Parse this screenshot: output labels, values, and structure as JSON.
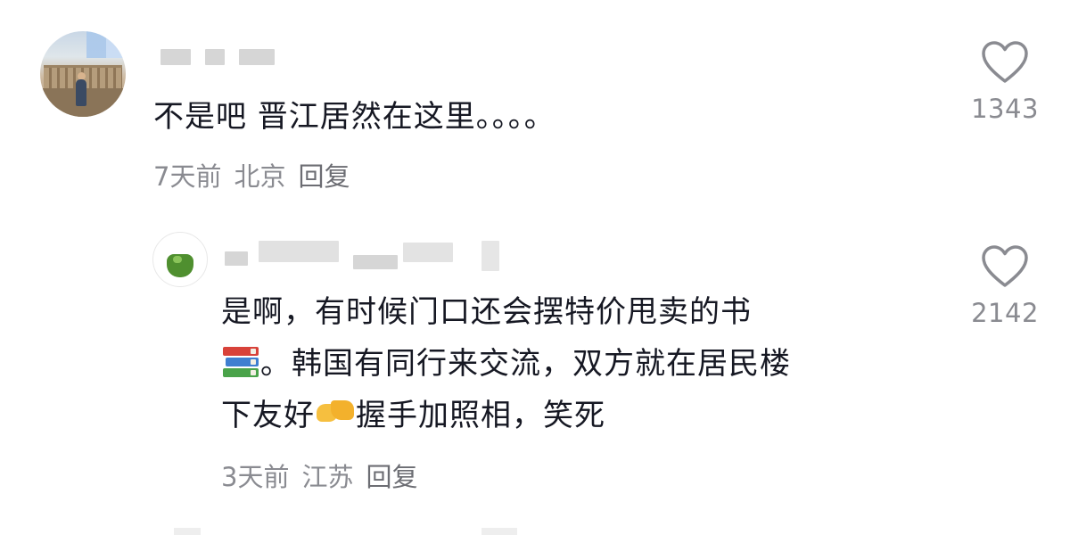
{
  "colors": {
    "text_primary": "#161823",
    "text_secondary": "#8a8b91",
    "heart_outline": "#8a8b91"
  },
  "comments": [
    {
      "text": "不是吧 晋江居然在这里。。。。",
      "time": "7天前",
      "location": "北京",
      "reply_label": "回复",
      "likes": "1343",
      "like_icon": "heart-outline-icon",
      "username_redacted": true
    },
    {
      "text_line1": "是啊，有时候门口还会摆特价甩卖的书",
      "text_line2": "。韩国有同行来交流，双方就在居民楼",
      "text_line3_a": "下友好",
      "text_line3_b": "握手加照相，笑死",
      "emoji_books": "books-emoji",
      "emoji_handshake": "handshake-emoji",
      "time": "3天前",
      "location": "江苏",
      "reply_label": "回复",
      "likes": "2142",
      "like_icon": "heart-outline-icon",
      "username_redacted": true
    }
  ]
}
